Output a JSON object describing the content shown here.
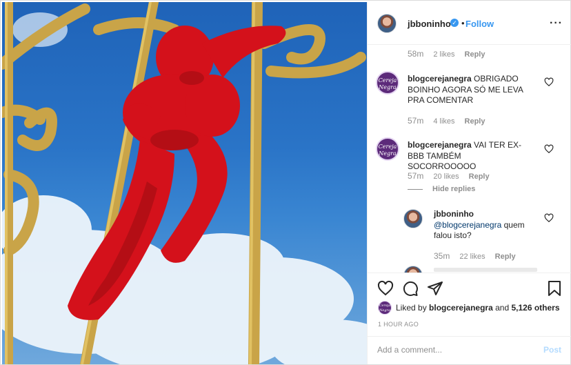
{
  "post": {
    "author": "jbboninho",
    "follow_label": "Follow",
    "more_icon": "more-options-icon",
    "verified_icon": "verified-badge-icon"
  },
  "comments": [
    {
      "time": "58m",
      "likes": "2 likes",
      "reply_label": "Reply"
    },
    {
      "user": "blogcerejanegra",
      "text": "OBRIGADO BOINHO AGORA SÓ ME LEVA PRA COMENTAR",
      "time": "57m",
      "likes": "4 likes",
      "reply_label": "Reply"
    },
    {
      "user": "blogcerejanegra",
      "text": "VAI TER EX-BBB TAMBÉM SOCORROOOOO",
      "time": "57m",
      "likes": "20 likes",
      "reply_label": "Reply",
      "hide_replies_label": "Hide replies"
    }
  ],
  "reply": {
    "user": "jbboninho",
    "mention": "@blogcerejanegra",
    "text": "quem falou isto?",
    "time": "35m",
    "likes": "22 likes",
    "reply_label": "Reply"
  },
  "avatar_logo_text": "Cereja Negra",
  "actions": {
    "liked_by_prefix": "Liked by",
    "liked_by_user": "blogcerejanegra",
    "and": "and",
    "others": "5,126 others",
    "time_ago": "1 HOUR AGO"
  },
  "add_comment": {
    "placeholder": "Add a comment...",
    "post_label": "Post"
  },
  "colors": {
    "link_blue": "#3897f0",
    "cupid_red": "#d4111b",
    "gate_gold": "#c9a448",
    "sky_blue": "#2a74c7"
  }
}
